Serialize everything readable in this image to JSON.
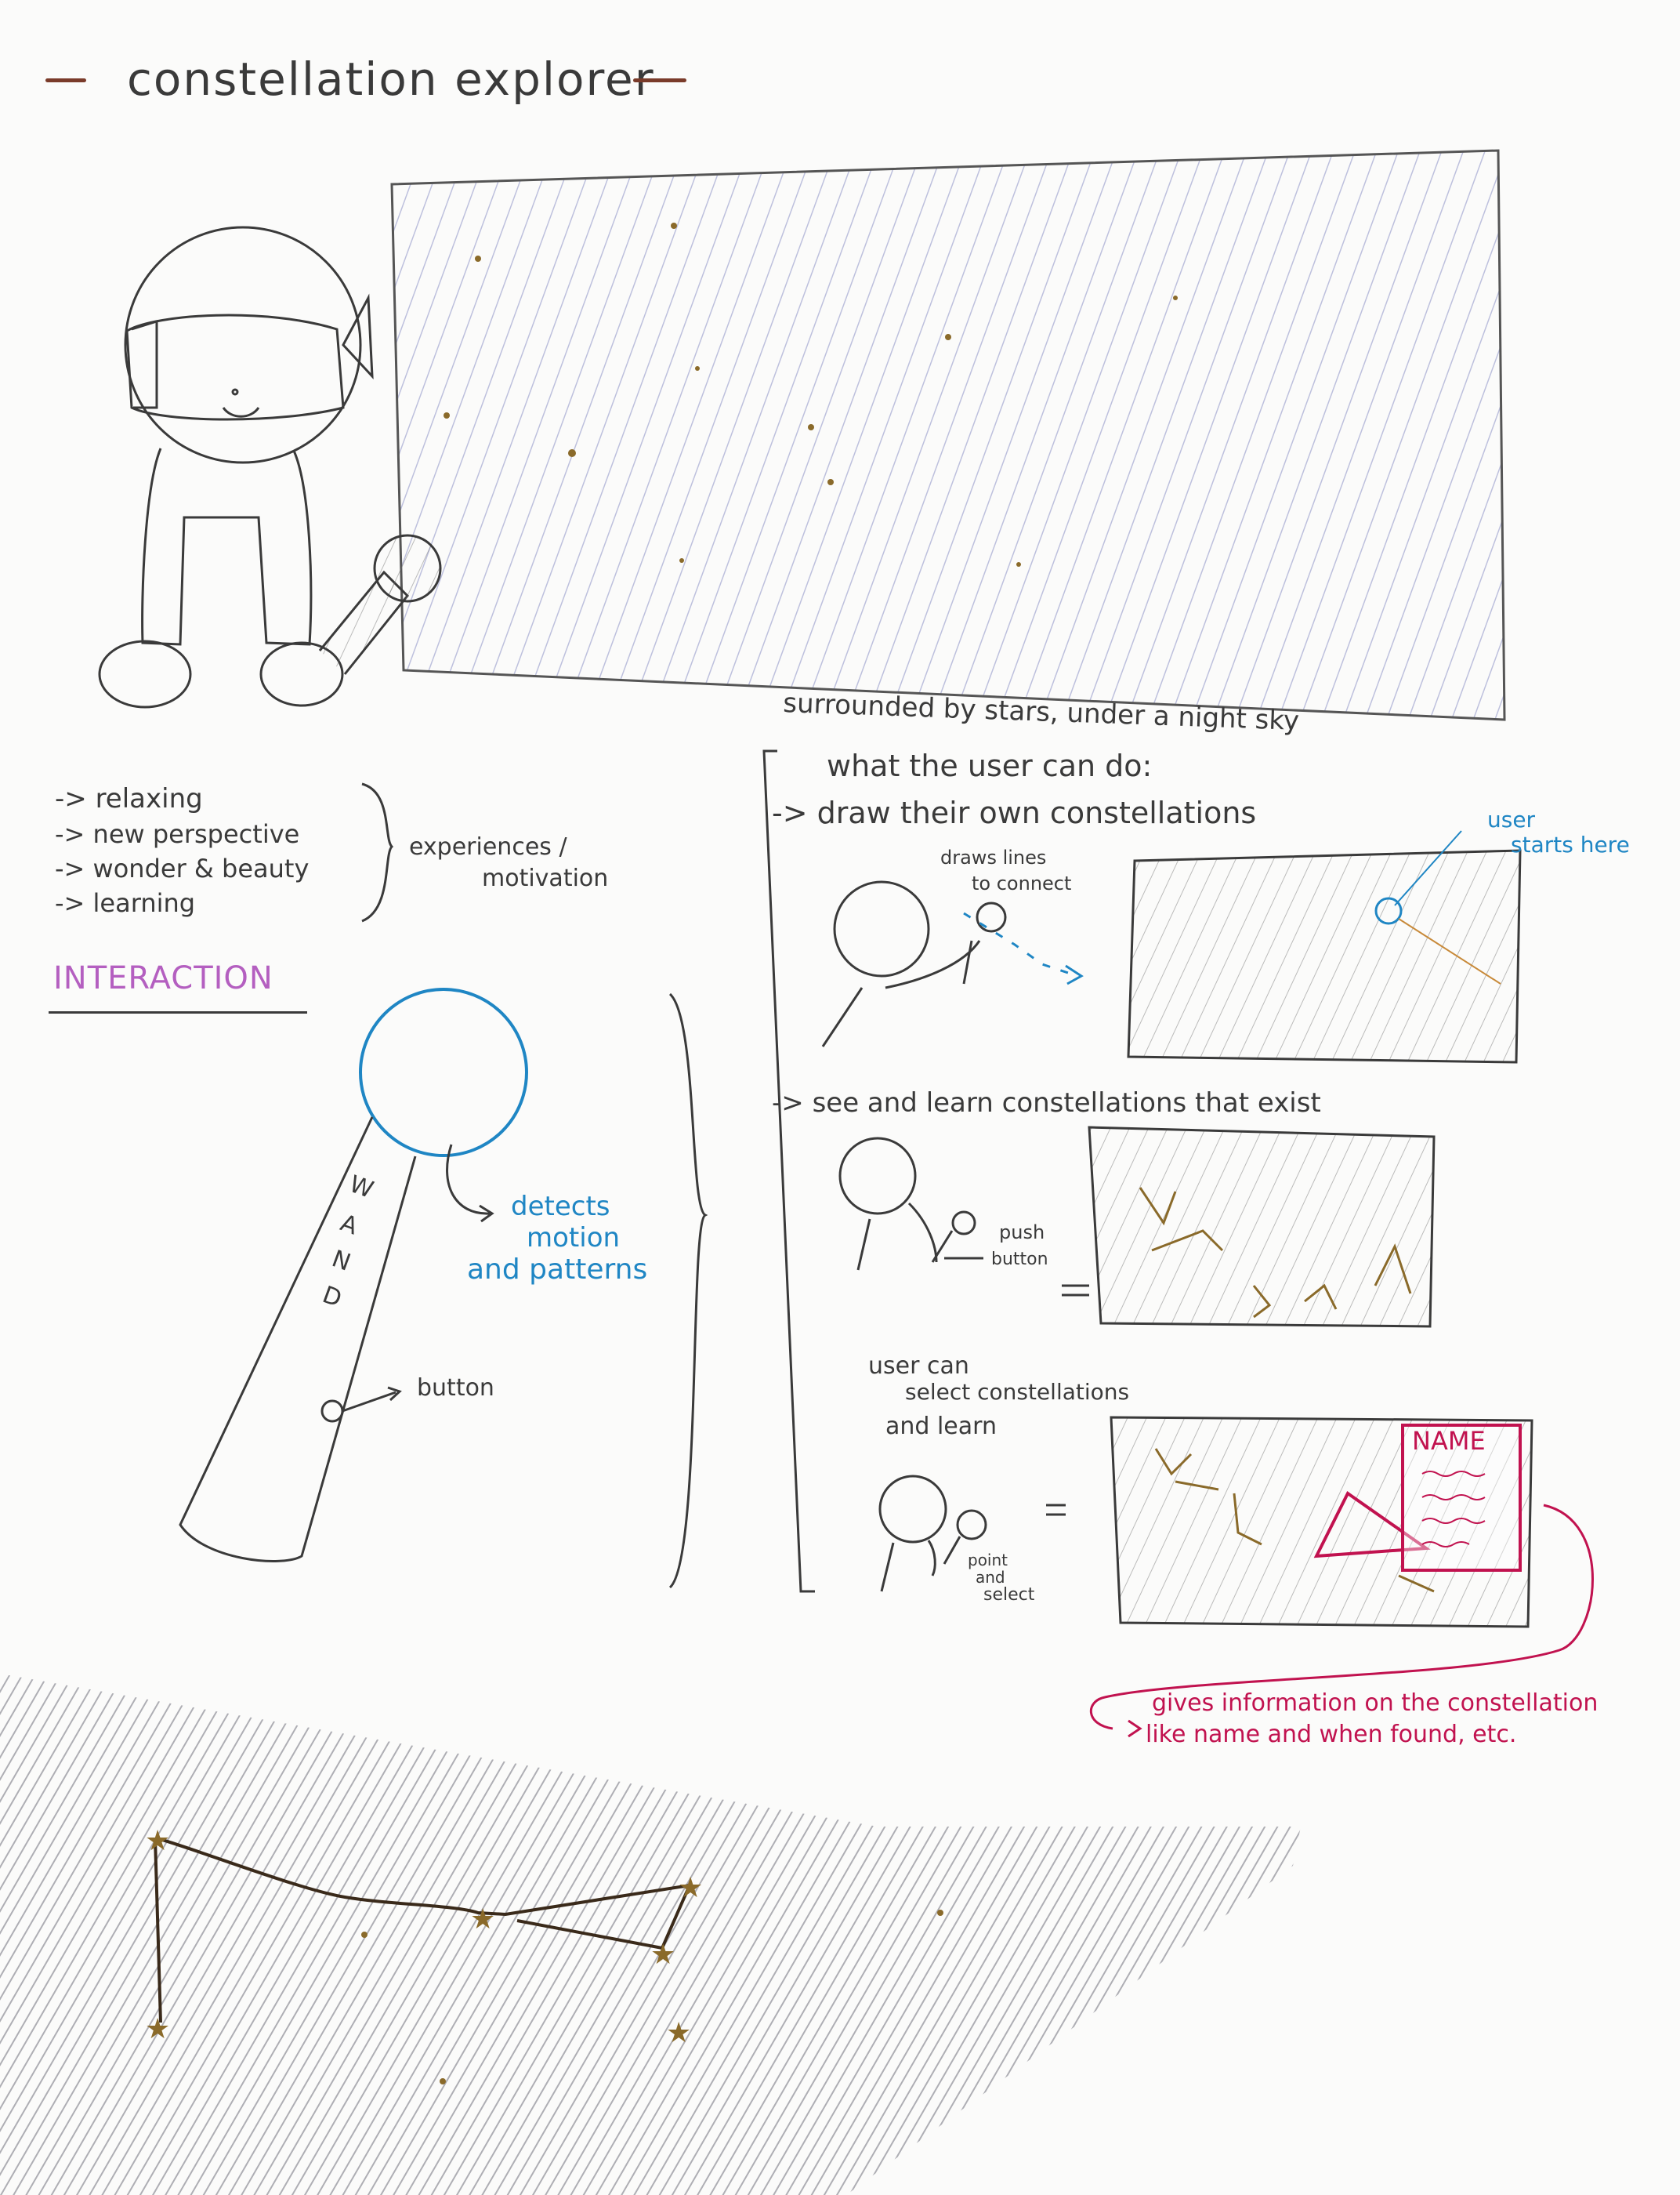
{
  "title": "constellation explorer",
  "hero": {
    "caption": "surrounded by stars, under a night sky"
  },
  "experiences": {
    "items": [
      "-> relaxing",
      "-> new perspective",
      "-> wonder & beauty",
      "-> learning"
    ],
    "label_line1": "experiences /",
    "label_line2": "motivation"
  },
  "interaction": {
    "heading": "INTERACTION",
    "wand_label": [
      "W",
      "A",
      "N",
      "D"
    ],
    "detects_line1": "detects",
    "detects_line2": "motion",
    "detects_line3": "and patterns",
    "button_label": "button"
  },
  "user_can_do": {
    "heading": "what the user can do:",
    "draw": {
      "label": "-> draw their own constellations",
      "draws_lines_1": "draws lines",
      "draws_lines_2": "to connect",
      "user_starts_1": "user",
      "user_starts_2": "starts here"
    },
    "see": {
      "label": "-> see and learn constellations that exist",
      "push_1": "push",
      "push_2": "button"
    },
    "select": {
      "line1": "user can",
      "line2": "select constellations",
      "line3": "and learn",
      "point_1": "point",
      "point_2": "and",
      "point_3": "select",
      "name_card": "NAME",
      "info_1": "gives information on the constellation",
      "info_2": "like name and when found, etc."
    }
  },
  "colors": {
    "pencil": "#3a3a3a",
    "sky": "#8a8fc4",
    "blue": "#1f86c4",
    "purple": "#b45fc0",
    "magenta": "#c1124f",
    "star": "#8a6a2a"
  }
}
